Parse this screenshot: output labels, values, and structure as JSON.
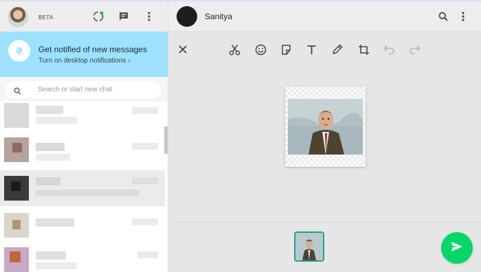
{
  "left_header": {
    "beta_label": "BETA",
    "icons": [
      "status-icon",
      "new-chat-icon",
      "menu-icon"
    ]
  },
  "notification": {
    "title": "Get notified of new messages",
    "subtitle": "Turn on desktop notifications ›",
    "icon": "bell-off-icon"
  },
  "search": {
    "placeholder": "Search or start new chat",
    "icon": "search-icon"
  },
  "conversation": {
    "contact_name": "Sanitya",
    "header_icons": [
      "search-icon",
      "menu-icon"
    ]
  },
  "editor": {
    "tools": [
      "close-icon",
      "scissors-icon",
      "emoji-icon",
      "sticker-icon",
      "text-icon",
      "pen-icon",
      "crop-icon",
      "undo-icon",
      "redo-icon"
    ]
  },
  "colors": {
    "notification_bg": "#9de1fe",
    "send_button": "#08d666",
    "thumb_border": "#17a78b",
    "status_dot": "#1dbf73"
  }
}
